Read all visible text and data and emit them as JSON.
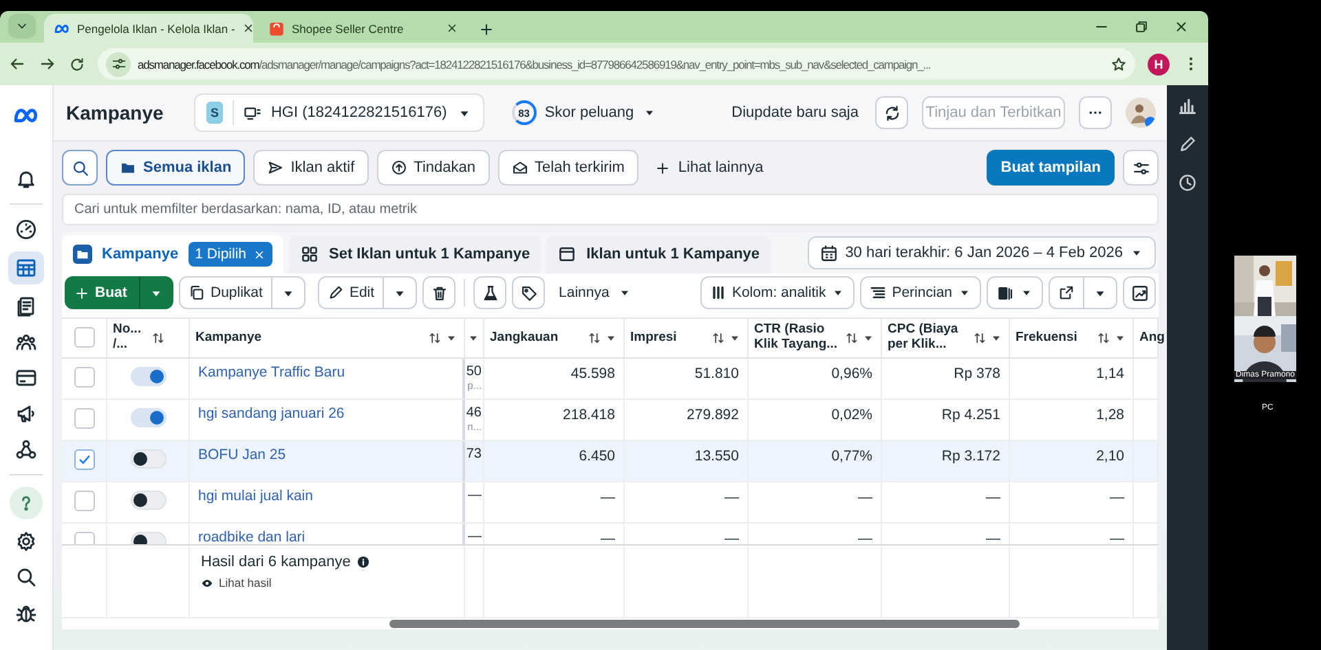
{
  "browser": {
    "tabs": [
      {
        "title": "Pengelola Iklan - Kelola Iklan -",
        "selected": true
      },
      {
        "title": "Shopee Seller Centre",
        "selected": false
      }
    ],
    "url_host": "adsmanager.facebook.com",
    "url_path": "/adsmanager/manage/campaigns?act=1824122821516176&business_id=877986642586919&nav_entry_point=mbs_sub_nav&selected_campaign_...",
    "profile_initial": "H"
  },
  "header": {
    "title": "Kampanye",
    "account_badge": "S",
    "account": "HGI (1824122821516176)",
    "score": "83",
    "score_label": "Skor peluang",
    "status": "Diupdate baru saja",
    "publish": {
      "label": "Tinjau dan Terbitkan",
      "disabled": true
    }
  },
  "filters": [
    {
      "label": "Semua iklan",
      "selected": true
    },
    {
      "label": "Iklan aktif",
      "selected": false
    },
    {
      "label": "Tindakan",
      "selected": false
    },
    {
      "label": "Telah terkirim",
      "selected": false
    }
  ],
  "more_filters": "Lihat lainnya",
  "create_view": "Buat tampilan",
  "search": {
    "placeholder": "Cari untuk memfilter berdasarkan: nama, ID, atau metrik"
  },
  "level_tabs": [
    {
      "label": "Kampanye",
      "badge": "1 Dipilih",
      "selected": true
    },
    {
      "label": "Set Iklan untuk 1 Kampanye",
      "selected": false
    },
    {
      "label": "Iklan untuk 1 Kampanye",
      "selected": false
    }
  ],
  "date_range": "30 hari terakhir: 6 Jan 2026 – 4 Feb 2026",
  "toolbar": {
    "create": "Buat",
    "duplicate": "Duplikat",
    "edit": "Edit",
    "more": "Lainnya",
    "columns": "Kolom: analitik",
    "breakdown": "Perincian"
  },
  "sidebar": {
    "items": [
      {
        "selected": false
      },
      {
        "selected": true
      },
      {
        "selected": false
      },
      {
        "selected": false
      },
      {
        "selected": false
      },
      {
        "selected": false
      },
      {
        "selected": false
      }
    ]
  },
  "table": {
    "select_all": {
      "checked": false
    },
    "status_column": "No... /...",
    "name_column": "Kampanye",
    "columns": [
      {
        "label": "Jangkauan"
      },
      {
        "label": "Impresi"
      },
      {
        "label": "CTR (Rasio Klik Tayang..."
      },
      {
        "label": "CPC (Biaya per Klik..."
      },
      {
        "label": "Frekuensi"
      },
      {
        "label": "Ang"
      }
    ],
    "rows": [
      {
        "name": "Kampanye Traffic Baru",
        "checked": false,
        "on": true,
        "partial": [
          "50",
          "p..."
        ],
        "cells": [
          "45.598",
          "51.810",
          "0,96%",
          "Rp 378",
          "1,14"
        ]
      },
      {
        "name": "hgi sandang januari 26",
        "checked": false,
        "on": true,
        "partial": [
          "46",
          "n..."
        ],
        "cells": [
          "218.418",
          "279.892",
          "0,02%",
          "Rp 4.251",
          "1,28"
        ]
      },
      {
        "name": "BOFU Jan 25",
        "checked": true,
        "on": false,
        "partial": [
          "73"
        ],
        "cells": [
          "6.450",
          "13.550",
          "0,77%",
          "Rp 3.172",
          "2,10"
        ]
      },
      {
        "name": "hgi mulai jual kain",
        "checked": false,
        "on": false,
        "partial": [
          "—"
        ],
        "cells": [
          "—",
          "—",
          "—",
          "—",
          "—"
        ]
      },
      {
        "name": "roadbike dan lari",
        "checked": false,
        "on": false,
        "partial": [
          "—"
        ],
        "cells": [
          "—",
          "—",
          "—",
          "—",
          "—"
        ]
      }
    ],
    "footer": {
      "summary": "Hasil dari 6 kampanye",
      "link": "Lihat hasil"
    }
  },
  "video_call": {
    "participant": "Dimas Pramono",
    "device": "PC"
  }
}
